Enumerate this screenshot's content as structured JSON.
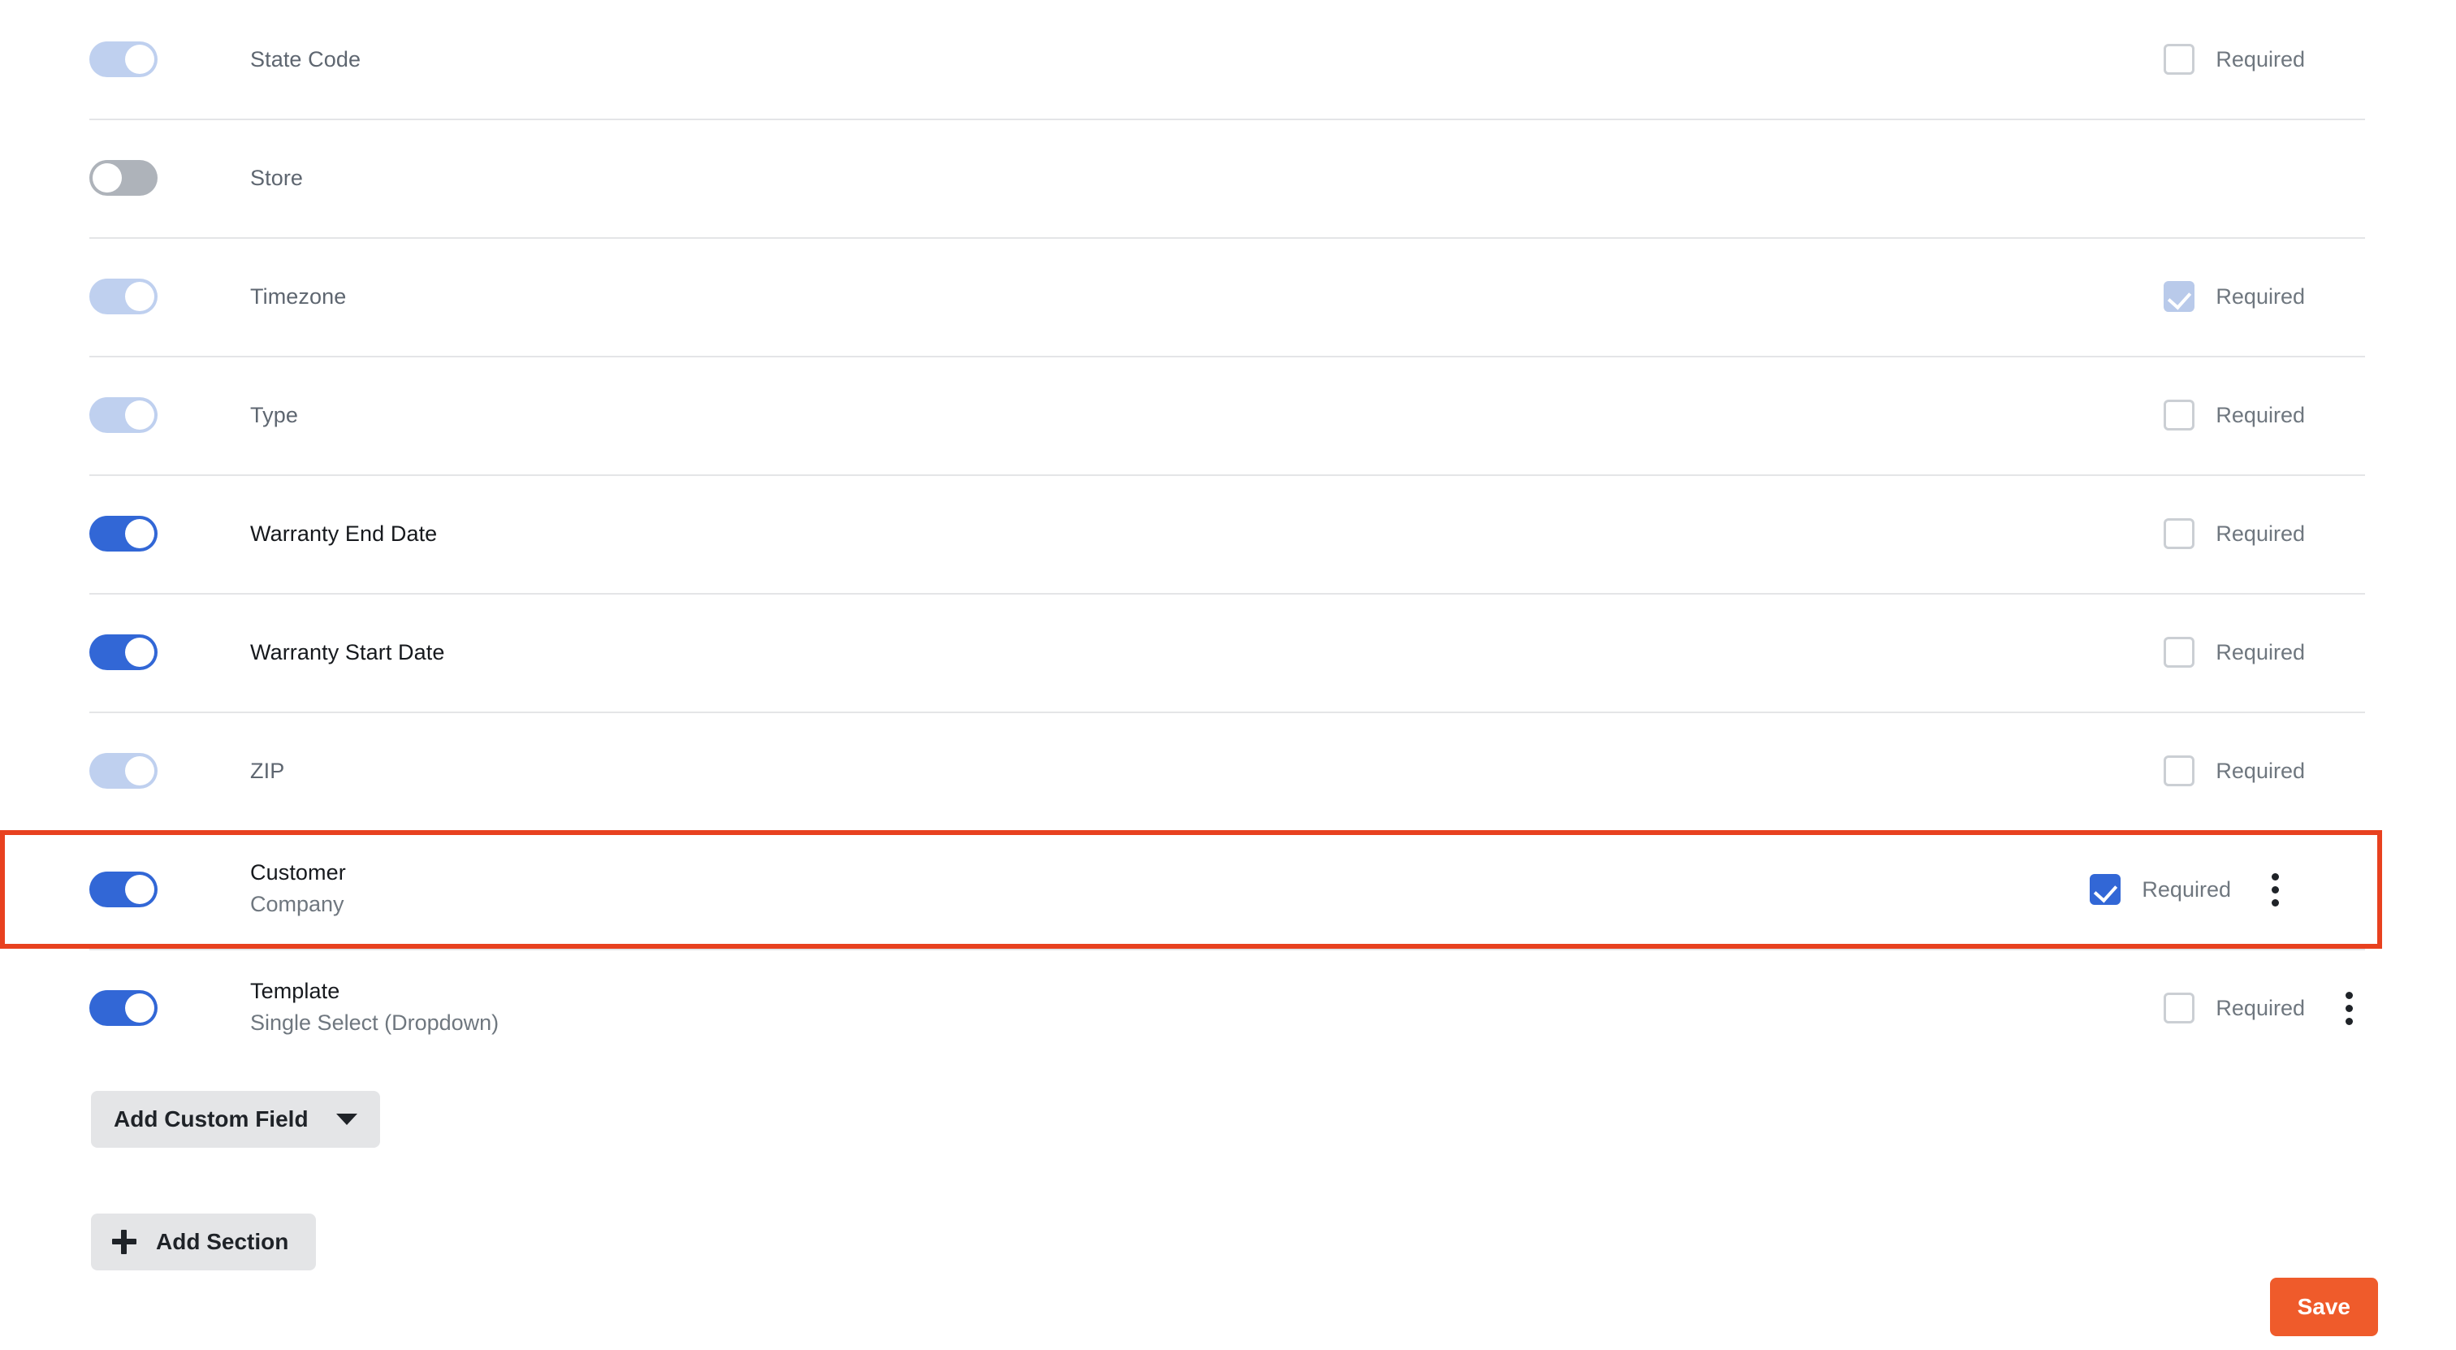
{
  "fields": [
    {
      "name": "State Code",
      "subtitle": "",
      "toggle": "on-disabled",
      "required_state": "unchecked",
      "required_label": "Required",
      "has_menu": false,
      "highlighted": false,
      "label_emphasis": "normal"
    },
    {
      "name": "Store",
      "subtitle": "",
      "toggle": "off",
      "required_state": "none",
      "required_label": "",
      "has_menu": false,
      "highlighted": false,
      "label_emphasis": "normal"
    },
    {
      "name": "Timezone",
      "subtitle": "",
      "toggle": "on-disabled",
      "required_state": "checked-disabled",
      "required_label": "Required",
      "has_menu": false,
      "highlighted": false,
      "label_emphasis": "normal"
    },
    {
      "name": "Type",
      "subtitle": "",
      "toggle": "on-disabled",
      "required_state": "unchecked",
      "required_label": "Required",
      "has_menu": false,
      "highlighted": false,
      "label_emphasis": "normal"
    },
    {
      "name": "Warranty End Date",
      "subtitle": "",
      "toggle": "on-active",
      "required_state": "unchecked",
      "required_label": "Required",
      "has_menu": false,
      "highlighted": false,
      "label_emphasis": "strong"
    },
    {
      "name": "Warranty Start Date",
      "subtitle": "",
      "toggle": "on-active",
      "required_state": "unchecked",
      "required_label": "Required",
      "has_menu": false,
      "highlighted": false,
      "label_emphasis": "strong"
    },
    {
      "name": "ZIP",
      "subtitle": "",
      "toggle": "on-disabled",
      "required_state": "unchecked",
      "required_label": "Required",
      "has_menu": false,
      "highlighted": false,
      "label_emphasis": "normal"
    },
    {
      "name": "Customer",
      "subtitle": "Company",
      "toggle": "on-active",
      "required_state": "checked-active",
      "required_label": "Required",
      "has_menu": true,
      "highlighted": true,
      "label_emphasis": "strong"
    },
    {
      "name": "Template",
      "subtitle": "Single Select (Dropdown)",
      "toggle": "on-active",
      "required_state": "unchecked",
      "required_label": "Required",
      "has_menu": true,
      "highlighted": false,
      "label_emphasis": "strong"
    }
  ],
  "buttons": {
    "add_custom_field": "Add Custom Field",
    "add_section": "Add Section",
    "save": "Save"
  },
  "colors": {
    "toggle_on": "#3267d6",
    "toggle_on_disabled": "#bfd0ef",
    "toggle_off": "#aeb3ba",
    "checkbox_checked": "#3267d6",
    "checkbox_checked_disabled": "#b9caea",
    "highlight_border": "#e8411f",
    "save_button": "#ef5b2b",
    "button_grey": "#e4e5e7",
    "divider": "#e4e5e7"
  }
}
